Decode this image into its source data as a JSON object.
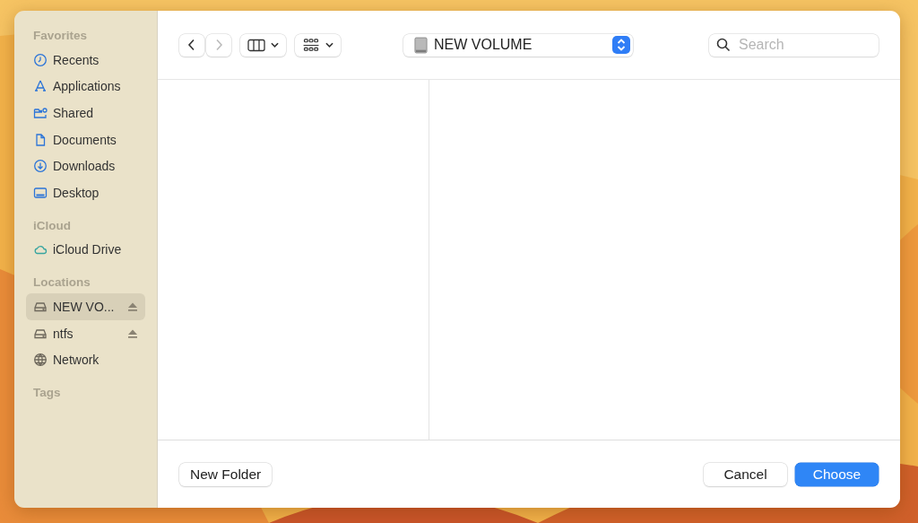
{
  "sidebar": {
    "sections": [
      {
        "title": "Favorites",
        "items": [
          {
            "label": "Recents",
            "kind": "clock",
            "selected": false
          },
          {
            "label": "Applications",
            "kind": "apps",
            "selected": false
          },
          {
            "label": "Shared",
            "kind": "shared",
            "selected": false
          },
          {
            "label": "Documents",
            "kind": "document",
            "selected": false
          },
          {
            "label": "Downloads",
            "kind": "download",
            "selected": false
          },
          {
            "label": "Desktop",
            "kind": "desktop",
            "selected": false
          }
        ]
      },
      {
        "title": "iCloud",
        "items": [
          {
            "label": "iCloud Drive",
            "kind": "cloud",
            "selected": false
          }
        ]
      },
      {
        "title": "Locations",
        "items": [
          {
            "label": "NEW VO...",
            "kind": "drive",
            "selected": true,
            "eject": true
          },
          {
            "label": "ntfs",
            "kind": "drive",
            "selected": false,
            "eject": true
          },
          {
            "label": "Network",
            "kind": "globe",
            "selected": false,
            "eject": false
          }
        ]
      },
      {
        "title": "Tags"
      }
    ]
  },
  "toolbar": {
    "back": {
      "disabled": false
    },
    "forward": {
      "disabled": true
    },
    "location": "NEW VOLUME",
    "search": {
      "placeholder": "Search"
    }
  },
  "buttons": [
    {
      "label": "New Folder",
      "kind": "secondary"
    },
    {
      "label": "Cancel",
      "kind": "secondary"
    },
    {
      "label": "Choose",
      "kind": "primary"
    }
  ]
}
